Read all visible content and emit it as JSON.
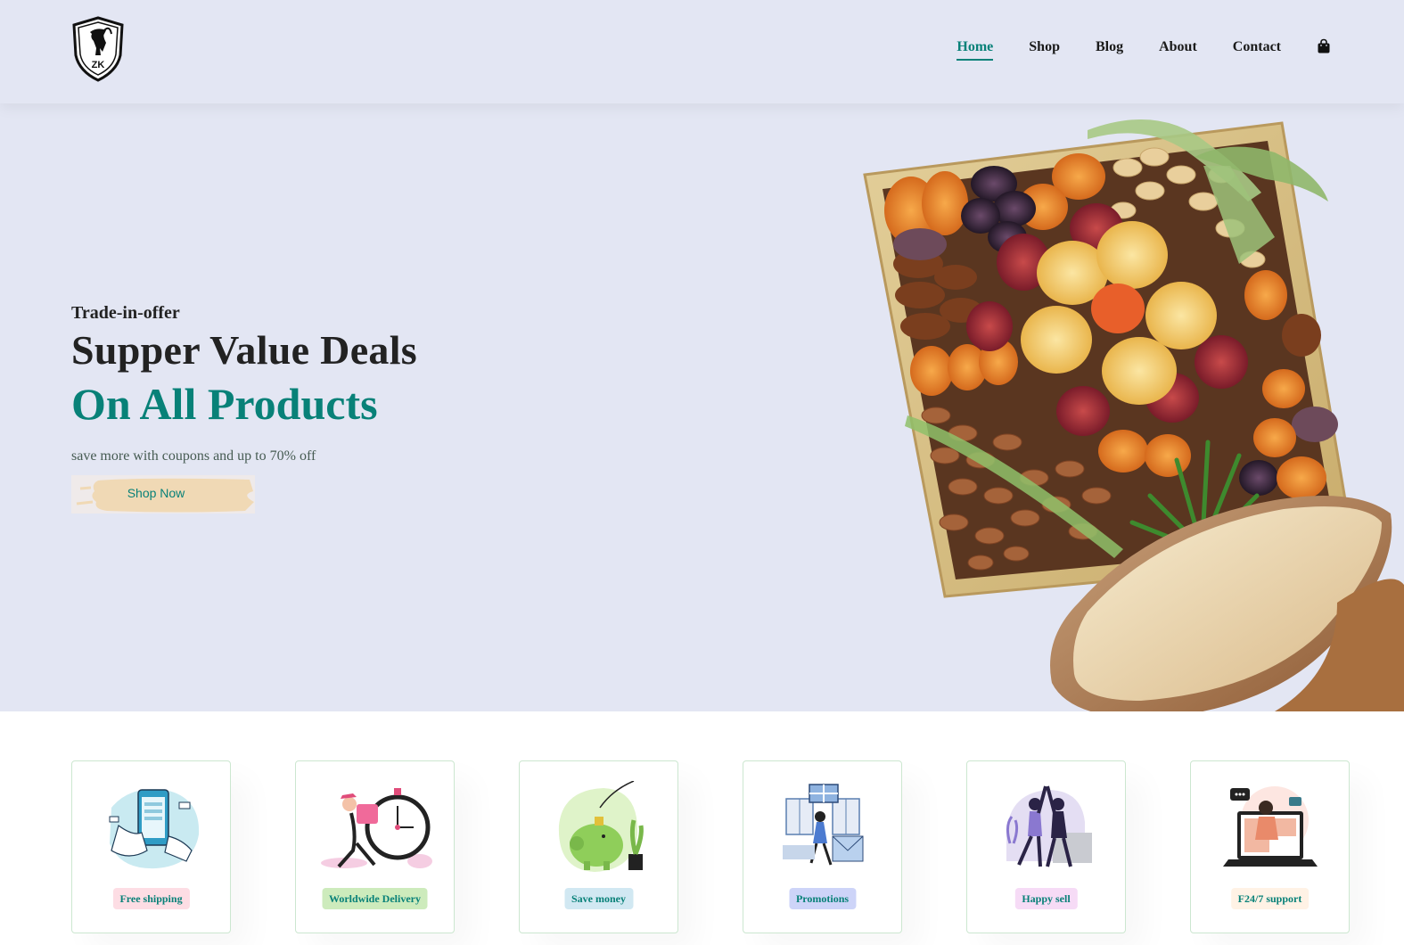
{
  "nav": {
    "items": [
      "Home",
      "Shop",
      "Blog",
      "About",
      "Contact"
    ],
    "active": "Home",
    "cart_icon": "shopping-bag-icon"
  },
  "logo": {
    "text": "ZK",
    "icon": "goat-shield-logo"
  },
  "hero": {
    "eyebrow": "Trade-in-offer",
    "title_line1": "Supper Value Deals",
    "title_line2": "On All Products",
    "tagline": "save more with coupons and up to 70% off",
    "button": "Shop Now"
  },
  "features": [
    {
      "label": "Free shipping",
      "icon": "mobile-payment-icon",
      "bg": "#fddde4"
    },
    {
      "label": "Worldwide Delivery",
      "icon": "delivery-clock-icon",
      "bg": "#cdebbc"
    },
    {
      "label": "Save money",
      "icon": "piggy-bank-icon",
      "bg": "#d1e8f2"
    },
    {
      "label": "Promotions",
      "icon": "promotion-icon",
      "bg": "#cdd4f8"
    },
    {
      "label": "Happy sell",
      "icon": "high-five-icon",
      "bg": "#f6dbf6"
    },
    {
      "label": "F24/7 support",
      "icon": "support-laptop-icon",
      "bg": "#fff2e5"
    }
  ],
  "colors": {
    "accent": "#088178",
    "hero_bg": "#e3e6f3",
    "button_bg": "#f0d9b5"
  }
}
